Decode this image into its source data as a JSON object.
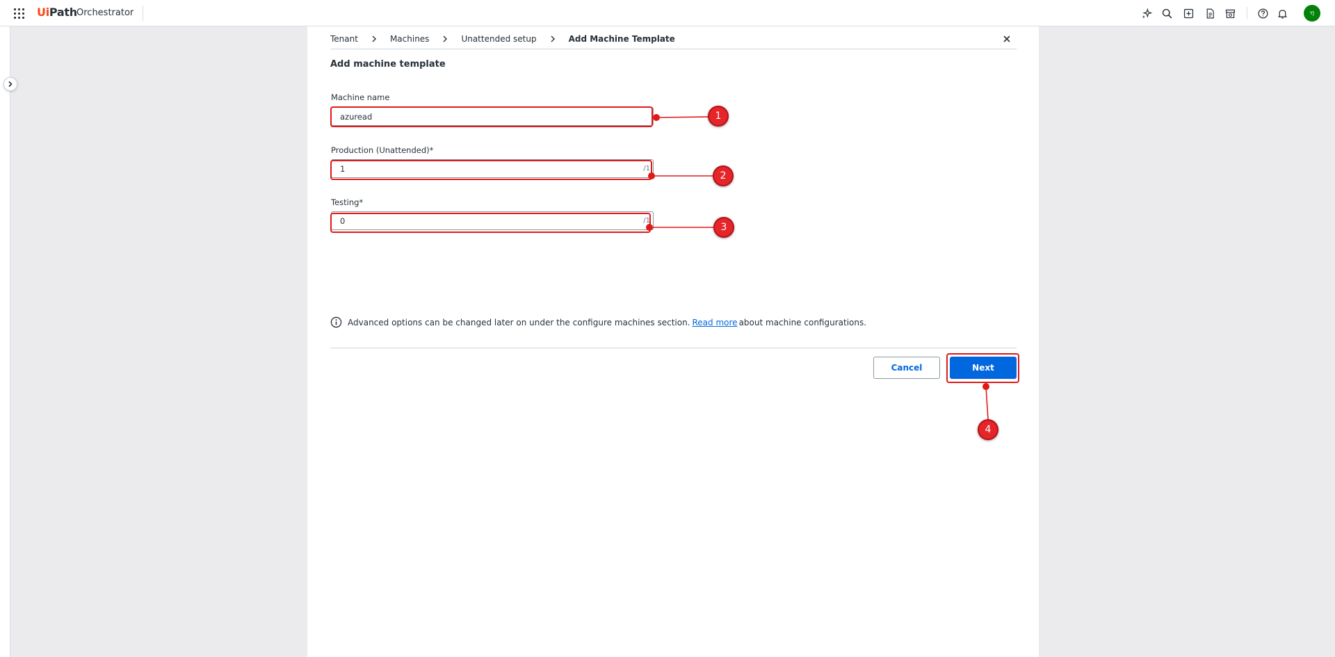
{
  "topbar": {
    "logo_prefix": "Ui",
    "logo_suffix": "Path",
    "app_name": "Orchestrator",
    "avatar_initials": "YJ",
    "icons": [
      "apps-grid-icon",
      "autopilot-sparkle-icon",
      "search-icon",
      "add-icon",
      "document-icon",
      "marketplace-icon",
      "help-icon",
      "notifications-bell-icon"
    ]
  },
  "breadcrumb": {
    "items": [
      "Tenant",
      "Machines",
      "Unattended setup",
      "Add Machine Template"
    ]
  },
  "form": {
    "title": "Add machine template",
    "machine_name": {
      "label": "Machine name",
      "value": "azuread"
    },
    "production": {
      "label": "Production (Unattended)*",
      "value": "1",
      "suffix": "/1"
    },
    "testing": {
      "label": "Testing*",
      "value": "0",
      "suffix": "/1"
    }
  },
  "info": {
    "text_before": "Advanced options can be changed later on under the configure machines section.",
    "link_text": "Read more",
    "text_after": "about machine configurations."
  },
  "actions": {
    "cancel_label": "Cancel",
    "next_label": "Next"
  },
  "annotations": {
    "markers": [
      "1",
      "2",
      "3",
      "4"
    ],
    "color": "#e5252a"
  },
  "colors": {
    "primary": "#0067df",
    "brand_orange": "#fa4616",
    "avatar": "#038108"
  }
}
